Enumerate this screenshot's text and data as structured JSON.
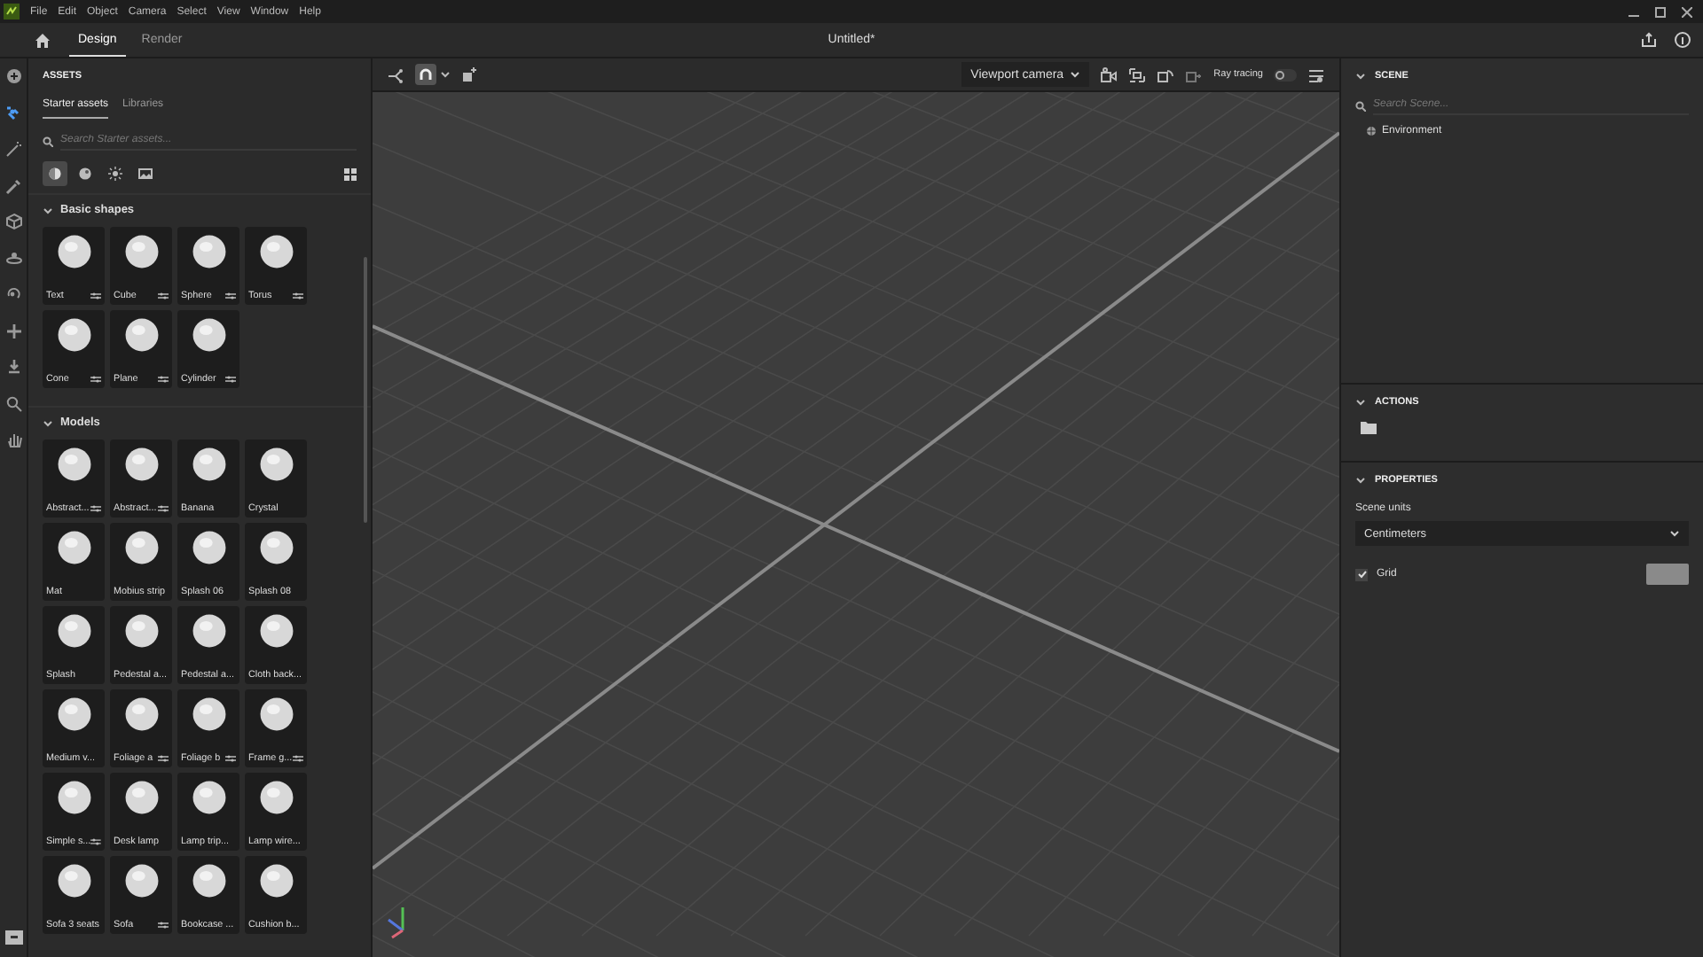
{
  "menu": [
    "File",
    "Edit",
    "Object",
    "Camera",
    "Select",
    "View",
    "Window",
    "Help"
  ],
  "tabs": [
    {
      "label": "Design",
      "selected": true
    },
    {
      "label": "Render",
      "selected": false
    }
  ],
  "document_title": "Untitled*",
  "tools": [
    {
      "selected": false
    },
    {
      "selected": true
    },
    {
      "selected": false
    },
    {
      "selected": false
    },
    {
      "selected": false
    },
    {
      "selected": false
    },
    {
      "selected": false
    },
    {
      "selected": false
    },
    {
      "selected": false
    },
    {
      "selected": false
    },
    {
      "selected": false
    }
  ],
  "assets": {
    "title": "ASSETS",
    "tabs": [
      {
        "label": "Starter assets",
        "selected": true
      },
      {
        "label": "Libraries",
        "selected": false
      }
    ],
    "search": {
      "placeholder": "Search Starter assets..."
    },
    "filters": [
      {
        "selected": true
      },
      {
        "selected": false
      },
      {
        "selected": false
      },
      {
        "selected": false
      }
    ],
    "sections": [
      {
        "title": "Basic shapes",
        "expanded": true,
        "items": [
          {
            "label": "Text",
            "adjustable": true
          },
          {
            "label": "Cube",
            "adjustable": true
          },
          {
            "label": "Sphere",
            "adjustable": true
          },
          {
            "label": "Torus",
            "adjustable": true
          },
          {
            "label": "Cone",
            "adjustable": true
          },
          {
            "label": "Plane",
            "adjustable": true
          },
          {
            "label": "Cylinder",
            "adjustable": true
          }
        ]
      },
      {
        "title": "Models",
        "expanded": true,
        "items": [
          {
            "label": "Abstract...",
            "adjustable": true
          },
          {
            "label": "Abstract...",
            "adjustable": true
          },
          {
            "label": "Banana",
            "adjustable": false
          },
          {
            "label": "Crystal",
            "adjustable": false
          },
          {
            "label": "Mat",
            "adjustable": false
          },
          {
            "label": "Mobius strip",
            "adjustable": false
          },
          {
            "label": "Splash 06",
            "adjustable": false
          },
          {
            "label": "Splash 08",
            "adjustable": false
          },
          {
            "label": "Splash",
            "adjustable": false
          },
          {
            "label": "Pedestal a...",
            "adjustable": false
          },
          {
            "label": "Pedestal a...",
            "adjustable": false
          },
          {
            "label": "Cloth back...",
            "adjustable": false
          },
          {
            "label": "Medium v...",
            "adjustable": false
          },
          {
            "label": "Foliage a",
            "adjustable": true
          },
          {
            "label": "Foliage b",
            "adjustable": true
          },
          {
            "label": "Frame g...",
            "adjustable": true
          },
          {
            "label": "Simple s...",
            "adjustable": true
          },
          {
            "label": "Desk lamp",
            "adjustable": false
          },
          {
            "label": "Lamp trip...",
            "adjustable": false
          },
          {
            "label": "Lamp wire...",
            "adjustable": false
          },
          {
            "label": "Sofa 3 seats",
            "adjustable": false
          },
          {
            "label": "Sofa",
            "adjustable": true
          },
          {
            "label": "Bookcase ...",
            "adjustable": false
          },
          {
            "label": "Cushion b...",
            "adjustable": false
          }
        ]
      }
    ]
  },
  "viewport": {
    "snap_selected": true,
    "camera": "Viewport camera",
    "ray_tracing": {
      "label": "Ray tracing",
      "on": false
    }
  },
  "scene": {
    "title": "SCENE",
    "expanded": true,
    "search": {
      "placeholder": "Search Scene..."
    },
    "items": [
      {
        "label": "Environment"
      }
    ]
  },
  "actions": {
    "title": "ACTIONS",
    "expanded": true
  },
  "properties": {
    "title": "PROPERTIES",
    "expanded": true,
    "scene_units": {
      "label": "Scene units",
      "value": "Centimeters"
    },
    "grid": {
      "label": "Grid",
      "checked": true
    }
  }
}
